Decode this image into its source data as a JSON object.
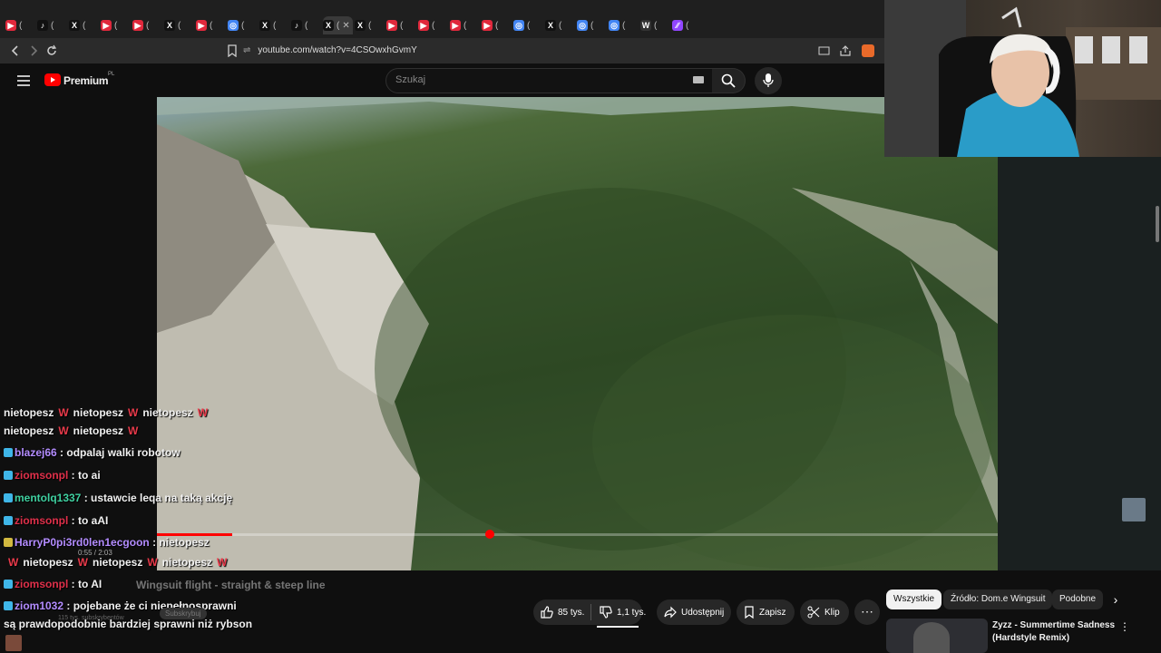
{
  "browser": {
    "url": "youtube.com/watch?v=4CSOwxhGvmY",
    "tabs": [
      "▶",
      "♪",
      "X",
      "▶",
      "▶",
      "X",
      "▶",
      "◎",
      "X",
      "♪",
      "X",
      "X",
      "▶",
      "▶",
      "▶",
      "▶",
      "◎",
      "X",
      "◎",
      "◎",
      "W",
      "∕∕"
    ],
    "active_tab_glyph": "(",
    "close_glyph": "✕"
  },
  "youtube": {
    "logo_text": "Premium",
    "region_badge": "PL",
    "search_placeholder": "Szukaj",
    "video_time": "0:55 / 2:03",
    "channel_subscribers": "115 tys. subskrybentów",
    "subscribe_label": "Subskrybuj",
    "actions": {
      "like": "85 tys.",
      "dislike": "1,1 tys.",
      "share": "Udostępnij",
      "save": "Zapisz",
      "clip": "Klip",
      "more": "⋯"
    },
    "chips": [
      "Wszystkie",
      "Źródło: Dom.e Wingsuit",
      "Podobne"
    ],
    "recommended_title_1": "Zyzz - Summertime Sadness",
    "recommended_title_2": "(Hardstyle Remix)",
    "title_overlay": "Wingsuit flight - straight & steep line",
    "progress_fraction": 0.09
  },
  "chat": [
    {
      "type": "spam",
      "text": "nietopesz",
      "w": "W"
    },
    {
      "user": "blazej66",
      "color": "#b38cff",
      "message": ": odpalaj walki robotow"
    },
    {
      "user": "ziomsonpl",
      "color": "#e0304a",
      "message": ": to ai"
    },
    {
      "user": "mentolq1337",
      "color": "#3fd0a0",
      "message": ": ustawcie leqa na taką akcję"
    },
    {
      "user": "ziomsonpl",
      "color": "#e0304a",
      "message": ": to aAI"
    },
    {
      "user": "HarryP0pi3rd0len1ecgoon",
      "color": "#b38cff",
      "message": ": nietopesz"
    },
    {
      "user": "ziomsonpl",
      "color": "#e0304a",
      "message": ": to AI"
    },
    {
      "user": "ziom1032",
      "color": "#b38cff",
      "message": ": pojebane że ci niepełnosprawni"
    },
    {
      "user": "",
      "color": "#fff",
      "message": "są prawdopodobnie bardziej sprawni niż rybson"
    }
  ]
}
